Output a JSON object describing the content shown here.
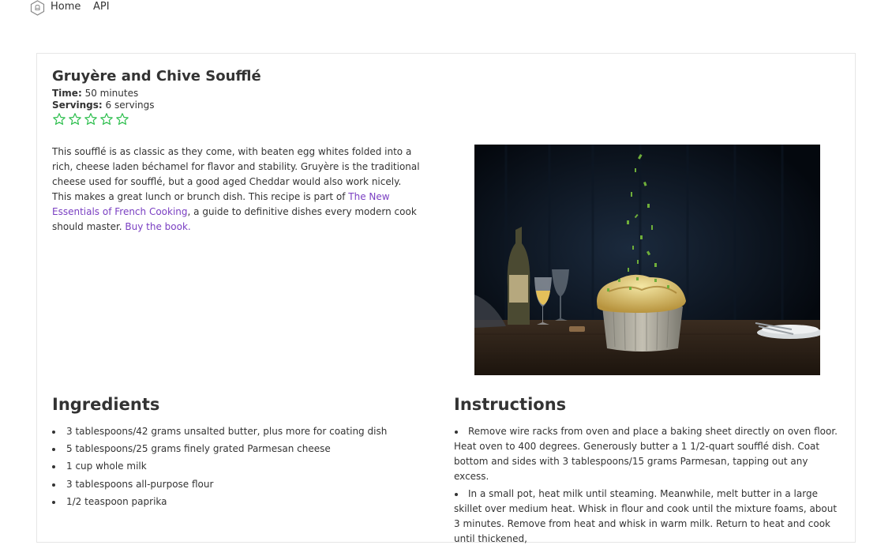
{
  "nav": {
    "logo_icon": "chef-hat-logo-icon",
    "items": [
      {
        "label": "Home"
      },
      {
        "label": "API"
      }
    ]
  },
  "recipe": {
    "title": "Gruyère and Chive Soufflé",
    "time_label": "Time:",
    "time_value": "50 minutes",
    "servings_label": "Servings:",
    "servings_value": "6 servings",
    "rating": {
      "value": 0,
      "max": 5,
      "icon": "star-outline-icon",
      "color": "#2fbf4f"
    },
    "description": {
      "text_before_link": "This soufflé is as classic as they come, with beaten egg whites folded into a rich, cheese laden béchamel for flavor and stability. Gruyère is the traditional cheese used for soufflé, but a good aged Cheddar would also work nicely. This makes a great lunch or brunch dish. This recipe is part of ",
      "book_link": "The New Essentials of French Cooking",
      "text_after_link": ", a guide to definitive dishes every modern cook should master. ",
      "buy_link": "Buy the book."
    },
    "photo": {
      "subject": "soufflé in ramekin with falling chives, wine bottle and glass on wooden table"
    }
  },
  "ingredients": {
    "heading": "Ingredients",
    "items": [
      "3 tablespoons/42 grams unsalted butter, plus more for coating dish",
      "5 tablespoons/25 grams finely grated Parmesan cheese",
      "1 cup whole milk",
      "3 tablespoons all-purpose flour",
      "1/2 teaspoon paprika"
    ]
  },
  "instructions": {
    "heading": "Instructions",
    "steps": [
      "Remove wire racks from oven and place a baking sheet directly on oven floor. Heat oven to 400 degrees. Generously butter a 1 1/2-quart soufflé dish. Coat bottom and sides with 3 tablespoons/15 grams Parmesan, tapping out any excess.",
      "In a small pot, heat milk until steaming. Meanwhile, melt butter in a large skillet over medium heat. Whisk in flour and cook until the mixture foams, about 3 minutes. Remove from heat and whisk in warm milk. Return to heat and cook until thickened,"
    ]
  },
  "colors": {
    "link": "#7a3fc2",
    "text": "#333333",
    "star": "#2fbf4f",
    "card_border": "#e6e6e6"
  }
}
